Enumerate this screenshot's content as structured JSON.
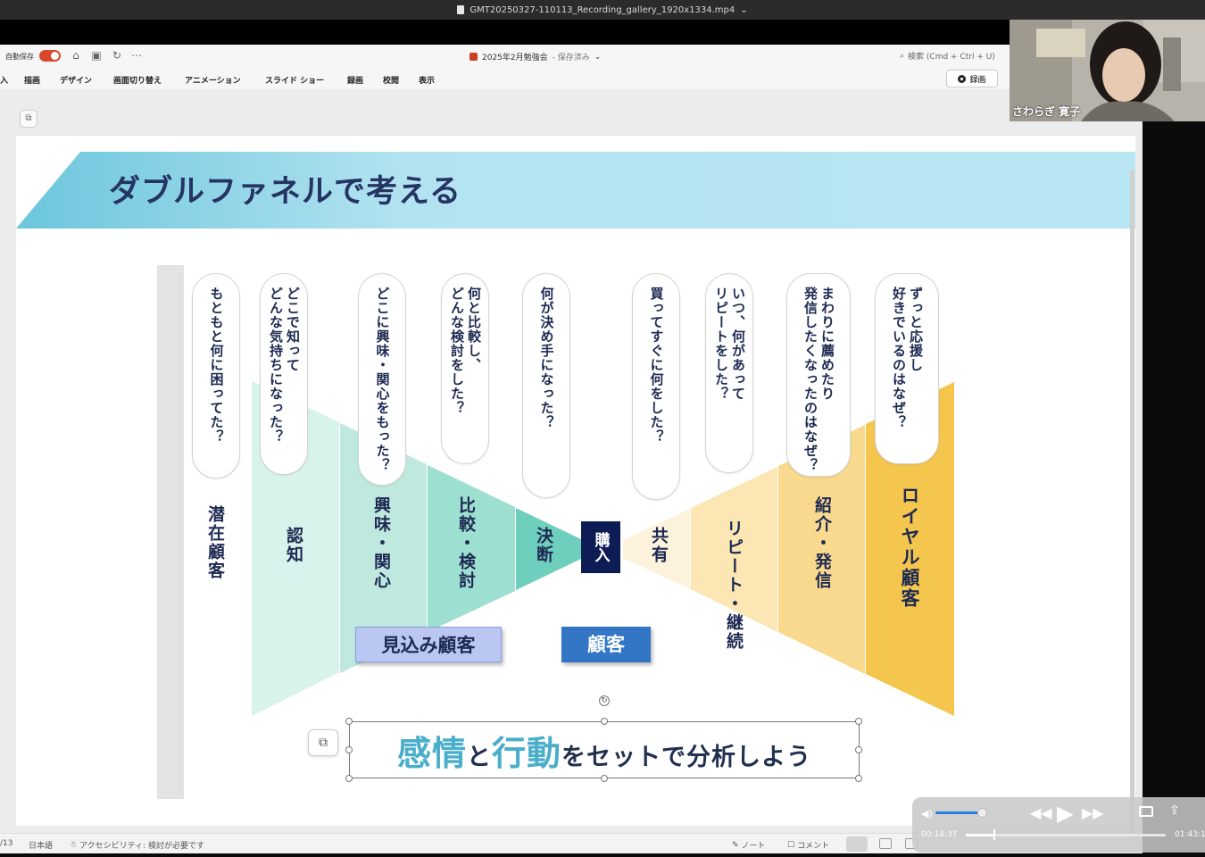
{
  "player": {
    "file_title": "GMT20250327-110113_Recording_gallery_1920x1334.mp4",
    "current_time": "00:14:37",
    "total_time": "01:43:1",
    "volume_fraction": 0.9,
    "progress_fraction": 0.14
  },
  "ppt": {
    "autosave_label": "自動保存",
    "doc_title": "2025年2月勉強会",
    "doc_status": "- 保存済み",
    "search_placeholder": "検索 (Cmd + Ctrl + U)",
    "record_button": "録画",
    "ribbon_tabs": [
      "入",
      "描画",
      "デザイン",
      "画面切り替え",
      "アニメーション",
      "スライド ショー",
      "録画",
      "校閲",
      "表示"
    ]
  },
  "slide": {
    "title": "ダブルファネルで考える",
    "questions": [
      "もともと何に困ってた？",
      "どこで知って\nどんな気持ちになった？",
      "どこに興味・関心をもった？",
      "何と比較し、\nどんな検討をした？",
      "何が決め手になった？",
      "買ってすぐに何をした？",
      "いつ、何があって\nリピートをした？",
      "まわりに薦めたり\n発信したくなったのはなぜ？",
      "ずっと応援し\n好きでいるのはなぜ？"
    ],
    "stages": {
      "latent": "潜在顧客",
      "awareness": "認知",
      "interest": "興味・関心",
      "compare": "比較・検討",
      "decision": "決断",
      "purchase": "購入",
      "share": "共有",
      "repeat": "リピート・継続",
      "referral": "紹介・発信",
      "loyal": "ロイヤル顧客"
    },
    "prospect_label": "見込み顧客",
    "customer_label": "顧客",
    "summary": {
      "word1": "感情",
      "conj": "と",
      "word2": "行動",
      "rest": "をセットで分析しよう"
    },
    "colors": {
      "funnel_left": "#7dd0bf",
      "funnel_right": "#f3c44d",
      "title_text": "#253463",
      "title_band": "#a9e0f0"
    }
  },
  "status": {
    "page": "/13",
    "language": "日本語",
    "accessibility": "アクセシビリティ: 検討が必要です",
    "notes": "ノート",
    "comments": "コメント"
  },
  "webcam": {
    "name": "さわらぎ 寛子"
  }
}
